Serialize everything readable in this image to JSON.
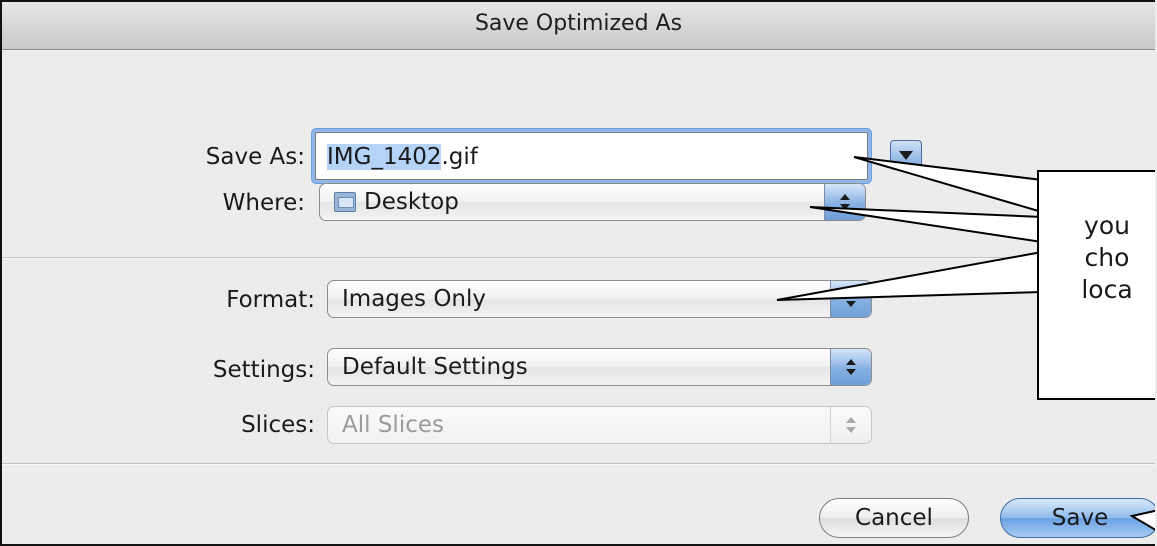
{
  "window": {
    "title": "Save Optimized As"
  },
  "save_as": {
    "label": "Save As:",
    "value_selected": "IMG_1402",
    "value_rest": ".gif"
  },
  "where": {
    "label": "Where:",
    "value": "Desktop",
    "icon": "folder-icon"
  },
  "format": {
    "label": "Format:",
    "value": "Images Only"
  },
  "settings": {
    "label": "Settings:",
    "value": "Default Settings"
  },
  "slices": {
    "label": "Slices:",
    "value": "All Slices"
  },
  "buttons": {
    "cancel": "Cancel",
    "save": "Save"
  },
  "callout": {
    "line1": "you",
    "line2": "cho",
    "line3": "loca"
  },
  "colors": {
    "accent": "#6aa1e3",
    "selection": "#b5d2f7",
    "focus_ring": "#8fb7ea"
  }
}
